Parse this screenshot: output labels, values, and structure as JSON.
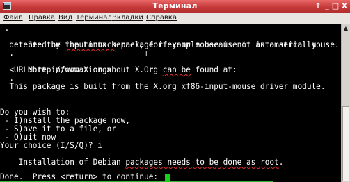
{
  "window": {
    "title": "Терминал",
    "controls": {
      "menu": "↑",
      "minimize": "_",
      "maximize": "□",
      "close": "X"
    }
  },
  "menubar": {
    "items": [
      "Файл",
      "Правка",
      "Вид",
      "Терминал",
      "Вкладки",
      "Справка"
    ]
  },
  "terminal": {
    "lines": [
      " .",
      "  See the inputattach package if your mouse is not automatically",
      "  detected by the Linux kernel, for example because it is a serial mouse.",
      "  .",
      "  More information about X.Org can be found at:",
      "  <URL:http://www.X.org>",
      "  .",
      "  This package is built from the X.org xf86-input-mouse driver module.",
      "",
      "",
      "Do you wish to:",
      " - I)nstall the package now,",
      " - S)ave it to a file, or",
      " - Q)uit now",
      "Your choice (I/S/Q)? i",
      "Installation of Debian packages needs to be done as root.",
      "",
      "Done.  Press <return> to continue: "
    ]
  },
  "colors": {
    "titlebar": "#c63a3a",
    "cursor": "#18d018",
    "box_border": "#2fb52f",
    "spell_underline": "#e23030"
  }
}
